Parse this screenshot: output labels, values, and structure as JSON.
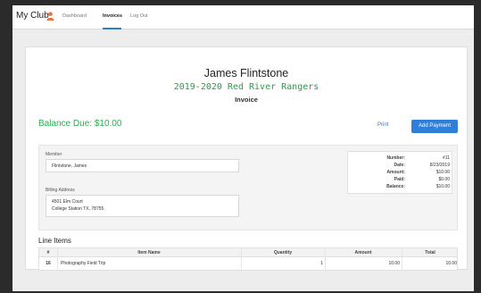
{
  "navbar": {
    "brand": "My Club",
    "items": [
      {
        "label": "Dashboard",
        "active": false
      },
      {
        "label": "Invoices",
        "active": true
      },
      {
        "label": "Log Out",
        "active": false
      }
    ]
  },
  "invoice": {
    "member_name": "James Flintstone",
    "team": "2019-2020 Red River Rangers",
    "subtitle": "Invoice",
    "balance_due": "Balance Due: $10.00",
    "actions": {
      "print": "Print",
      "add_payment": "Add Payment"
    }
  },
  "member_section": {
    "member_label": "Member",
    "member_value": "Flintstone, James",
    "billing_label": "Billing Address",
    "address_line1": "4501 Elm Court",
    "address_line2": "College Station TX, 78755"
  },
  "summary": [
    {
      "key": "Number:",
      "value": "#11"
    },
    {
      "key": "Date:",
      "value": "8/23/2019"
    },
    {
      "key": "Amount:",
      "value": "$10.00"
    },
    {
      "key": "Paid:",
      "value": "$0.00"
    },
    {
      "key": "Balance:",
      "value": "$10.00"
    }
  ],
  "line_items": {
    "title": "Line Items",
    "headers": [
      "#",
      "Item Name",
      "Quantity",
      "Amount",
      "Total"
    ],
    "rows": [
      {
        "num": "16",
        "name": "Photography Field Trip",
        "quantity": "1",
        "amount": "10.00",
        "total": "10.00"
      }
    ]
  },
  "colors": {
    "accent": "#2f7fd8",
    "balance_green": "#2eab4f",
    "team_green": "#2a9d48",
    "user_icon": "#e8743b"
  },
  "icons": [
    "user-icon"
  ]
}
